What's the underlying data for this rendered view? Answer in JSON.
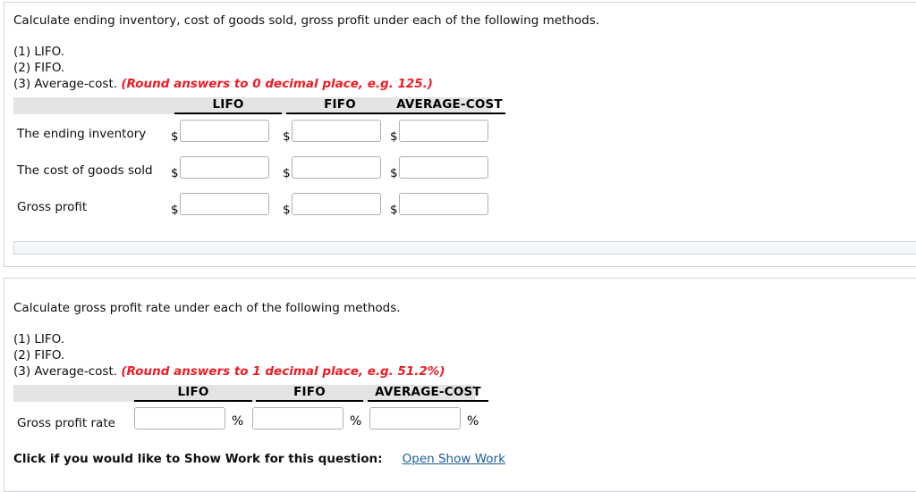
{
  "section1": {
    "lead": "Calculate ending inventory, cost of goods sold, gross profit under each of the following methods.",
    "methods": [
      "(1) LIFO.",
      "(2) FIFO.",
      "(3) Average-cost."
    ],
    "round_note": "(Round answers to 0 decimal place, e.g. 125.)",
    "table": {
      "columns": [
        "LIFO",
        "FIFO",
        "AVERAGE-COST"
      ],
      "rows": [
        {
          "label": "The ending inventory",
          "prefix": "$",
          "values": [
            "",
            "",
            ""
          ]
        },
        {
          "label": "The cost of goods sold",
          "prefix": "$",
          "values": [
            "",
            "",
            ""
          ]
        },
        {
          "label": "Gross profit",
          "prefix": "$",
          "values": [
            "",
            "",
            ""
          ]
        }
      ]
    }
  },
  "section2": {
    "lead": "Calculate gross profit rate under each of the following methods.",
    "methods": [
      "(1) LIFO.",
      "(2) FIFO.",
      "(3) Average-cost."
    ],
    "round_note": "(Round answers to 1 decimal place, e.g. 51.2%)",
    "table": {
      "columns": [
        "LIFO",
        "FIFO",
        "AVERAGE-COST"
      ],
      "rows": [
        {
          "label": "Gross profit rate",
          "suffix": "%",
          "values": [
            "",
            "",
            ""
          ]
        }
      ]
    },
    "show_work": {
      "label": "Click if you would like to Show Work for this question:",
      "link": "Open Show Work"
    }
  },
  "colors": {
    "note_red": "#ed1c24",
    "link_blue": "#1f5c99",
    "header_band": "#e4e4e4",
    "panel_border": "#ccd6e0",
    "action_bar": "#f4f8fb"
  }
}
